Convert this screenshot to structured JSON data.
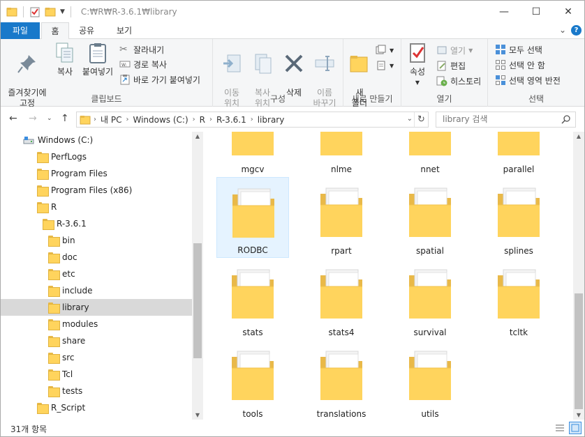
{
  "window": {
    "title": "C:₩R₩R-3.6.1₩library",
    "controls": {
      "minimize": "—",
      "maximize": "☐",
      "close": "✕"
    }
  },
  "tabs": {
    "file": "파일",
    "home": "홈",
    "share": "공유",
    "view": "보기"
  },
  "ribbon": {
    "clipboard": {
      "label": "클립보드",
      "pin": "즐겨찾기에\n고정",
      "copy": "복사",
      "paste": "붙여넣기",
      "cut": "잘라내기",
      "copy_path": "경로 복사",
      "paste_shortcut": "바로 가기 붙여넣기"
    },
    "organize": {
      "label": "구성",
      "move_to": "이동\n위치",
      "copy_to": "복사\n위치",
      "delete": "삭제",
      "rename": "이름\n바꾸기"
    },
    "new": {
      "label": "새로 만들기",
      "new_folder": "새\n폴더"
    },
    "open": {
      "label": "열기",
      "properties": "속성",
      "open": "열기",
      "edit": "편집",
      "history": "히스토리"
    },
    "select": {
      "label": "선택",
      "select_all": "모두 선택",
      "select_none": "선택 안 함",
      "invert": "선택 영역 반전"
    }
  },
  "address": {
    "crumbs": [
      "내 PC",
      "Windows (C:)",
      "R",
      "R-3.6.1",
      "library"
    ],
    "search_placeholder": "library 검색"
  },
  "tree": [
    {
      "label": "Windows (C:)",
      "level": 0,
      "drive": true
    },
    {
      "label": "PerfLogs",
      "level": 1
    },
    {
      "label": "Program Files",
      "level": 1
    },
    {
      "label": "Program Files (x86)",
      "level": 1
    },
    {
      "label": "R",
      "level": 1
    },
    {
      "label": "R-3.6.1",
      "level": 2
    },
    {
      "label": "bin",
      "level": 3
    },
    {
      "label": "doc",
      "level": 3
    },
    {
      "label": "etc",
      "level": 3
    },
    {
      "label": "include",
      "level": 3
    },
    {
      "label": "library",
      "level": 3,
      "selected": true
    },
    {
      "label": "modules",
      "level": 3
    },
    {
      "label": "share",
      "level": 3
    },
    {
      "label": "src",
      "level": 3
    },
    {
      "label": "Tcl",
      "level": 3
    },
    {
      "label": "tests",
      "level": 3
    },
    {
      "label": "R_Script",
      "level": 1
    }
  ],
  "folders": [
    {
      "name": "mgcv"
    },
    {
      "name": "nlme"
    },
    {
      "name": "nnet"
    },
    {
      "name": "parallel"
    },
    {
      "name": "RODBC",
      "selected": true
    },
    {
      "name": "rpart"
    },
    {
      "name": "spatial"
    },
    {
      "name": "splines"
    },
    {
      "name": "stats"
    },
    {
      "name": "stats4"
    },
    {
      "name": "survival"
    },
    {
      "name": "tcltk"
    },
    {
      "name": "tools"
    },
    {
      "name": "translations"
    },
    {
      "name": "utils"
    }
  ],
  "status": {
    "item_count": "31개 항목"
  },
  "colors": {
    "accent": "#1979ca",
    "folder": "#ffd45d",
    "selection": "#e5f3ff"
  }
}
